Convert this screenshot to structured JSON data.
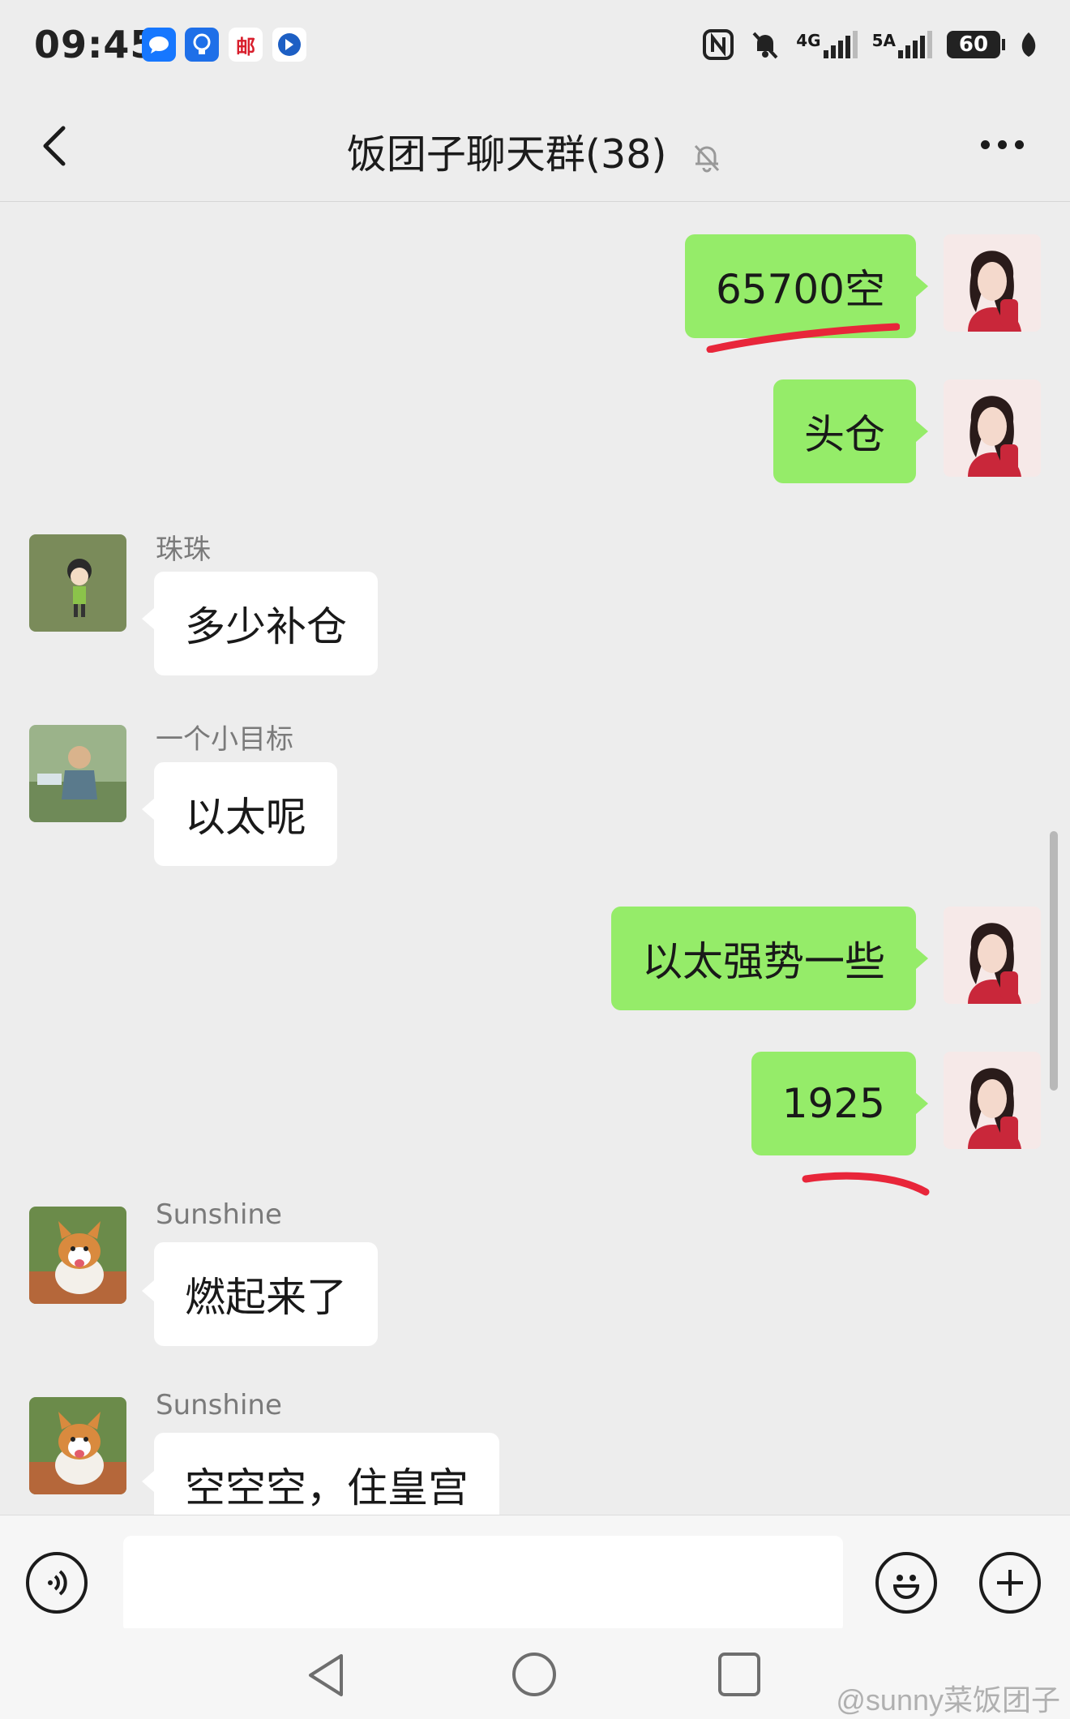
{
  "status_bar": {
    "time": "09:45",
    "network_1": "4G",
    "network_2": "5A",
    "battery": "60",
    "app_icon_post": "邮"
  },
  "header": {
    "title": "饭团子聊天群(38)",
    "icons": {
      "back": "chevron-left-icon",
      "mute": "bell-off-icon",
      "more": "more-dots-icon"
    }
  },
  "messages": [
    {
      "side": "right",
      "text": "65700空",
      "highlighted": true
    },
    {
      "side": "right",
      "text": "头仓"
    },
    {
      "side": "left",
      "sender": "珠珠",
      "text": "多少补仓"
    },
    {
      "side": "left",
      "sender": "一个小目标",
      "text": "以太呢"
    },
    {
      "side": "right",
      "text": "以太强势一些"
    },
    {
      "side": "right",
      "text": "1925",
      "highlighted": true
    },
    {
      "side": "left",
      "sender": "Sunshine",
      "text": "燃起来了"
    },
    {
      "side": "left",
      "sender": "Sunshine",
      "text": "空空空，住皇宫"
    }
  ],
  "input_bar": {
    "placeholder": "",
    "icons": {
      "voice": "voice-icon",
      "emoji": "emoji-icon",
      "add": "plus-icon"
    }
  },
  "nav_bar": {
    "icons": {
      "back": "nav-back-icon",
      "home": "nav-home-icon",
      "recents": "nav-recents-icon"
    }
  },
  "watermark": "@sunny菜饭团子",
  "colors": {
    "bubble_me": "#95ec69",
    "bubble_other": "#ffffff",
    "background": "#ededed",
    "underline": "#e8263a"
  }
}
